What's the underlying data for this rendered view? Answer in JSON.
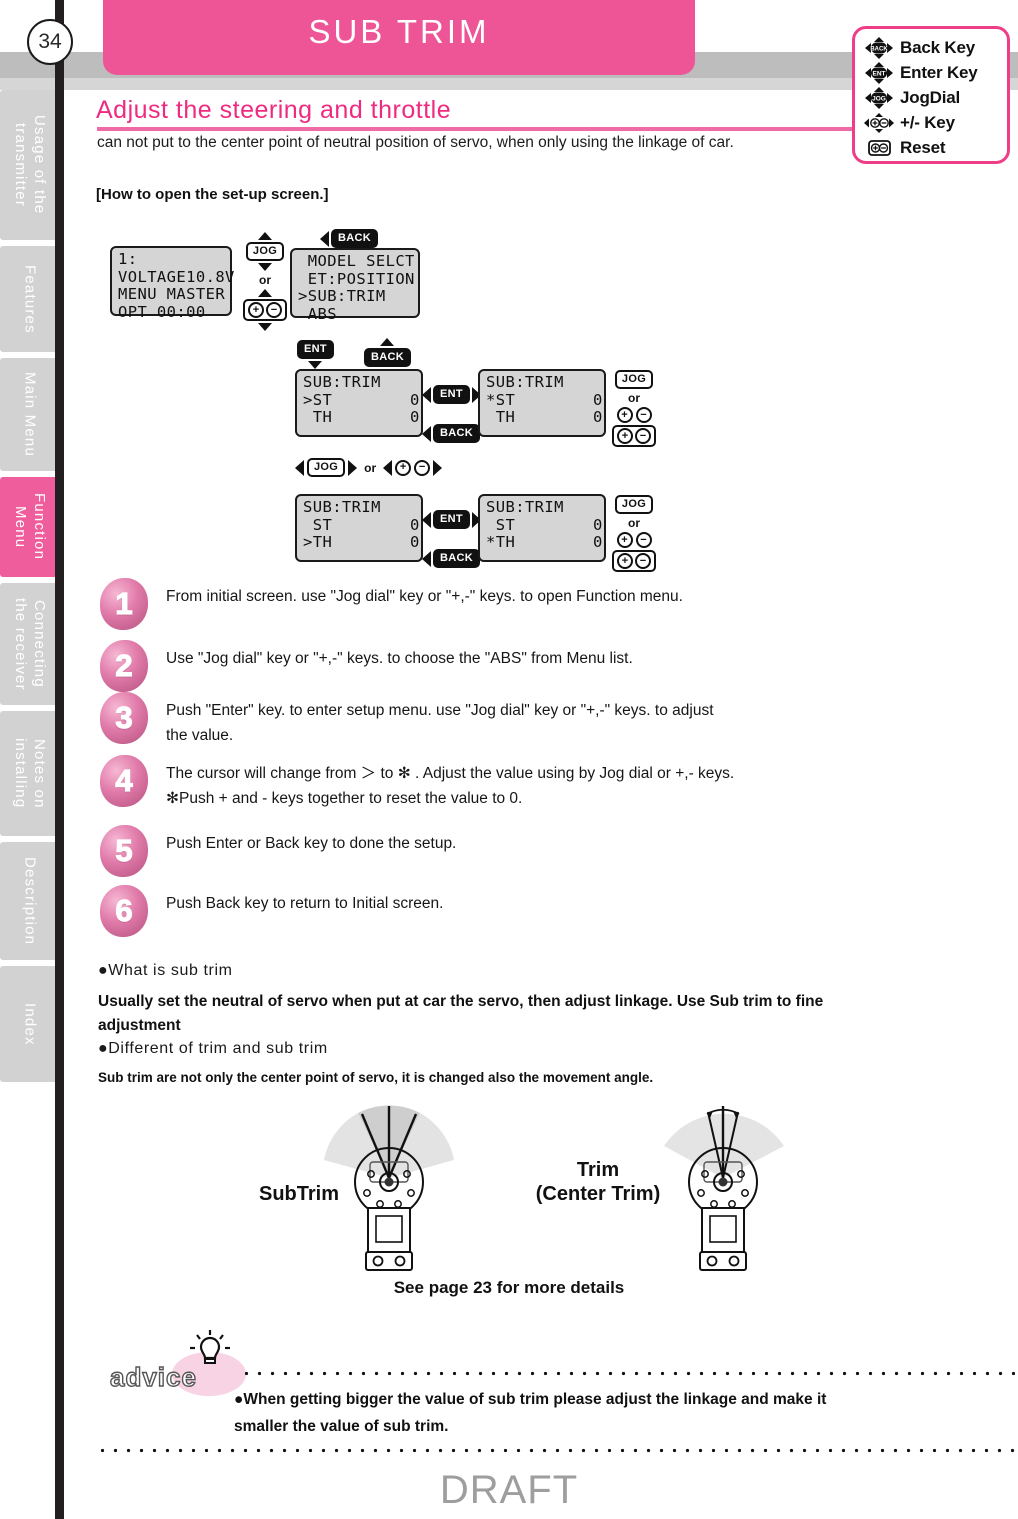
{
  "page": {
    "number": "34",
    "title": "SUB TRIM",
    "draft_watermark": "DRAFT",
    "accent_pink": "#ee2b80",
    "header_pink": "#ee5596"
  },
  "sidebar": {
    "tabs": [
      {
        "label": "Usage of the\ntransmitter",
        "active": false
      },
      {
        "label": "Features",
        "active": false
      },
      {
        "label": "Main Menu",
        "active": false
      },
      {
        "label": "Function Menu",
        "active": true
      },
      {
        "label": "Connecting\nthe receiver",
        "active": false
      },
      {
        "label": "Notes on\ninstalling",
        "active": false
      },
      {
        "label": "Description",
        "active": false
      },
      {
        "label": "Index",
        "active": false
      }
    ]
  },
  "key_legend": [
    {
      "icon": "back-key-icon",
      "key": "BACK",
      "label": "Back Key"
    },
    {
      "icon": "enter-key-icon",
      "key": "ENT",
      "label": "Enter Key"
    },
    {
      "icon": "jogdial-icon",
      "key": "JOG",
      "label": "JogDial"
    },
    {
      "icon": "plus-minus-key-icon",
      "key": "+-",
      "label": "+/- Key"
    },
    {
      "icon": "reset-key-icon",
      "key": "+-",
      "label": "Reset"
    }
  ],
  "section": {
    "heading": "Adjust the steering and throttle",
    "subtext": "can not put to the center point of neutral position of servo, when only using the linkage of car.",
    "howto_label": "[How to open the set-up screen.]"
  },
  "screens": {
    "initial": "1:\nVOLTAGE10.8V\nMENU MASTER\nOPT 00:00",
    "menu_list": " MODEL SELCT\n ET:POSITION\n>SUB:TRIM\n ABS",
    "subtrim_st_cursor": "SUB:TRIM\n>ST        0\n TH        0",
    "subtrim_st_selected": "SUB:TRIM\n*ST        0\n TH        0",
    "subtrim_th_cursor": "SUB:TRIM\n ST        0\n>TH        0",
    "subtrim_th_selected": "SUB:TRIM\n ST        0\n*TH        0"
  },
  "flow_labels": {
    "jog": "JOG",
    "ent": "ENT",
    "back": "BACK",
    "or": "or",
    "plus": "+",
    "minus": "−"
  },
  "steps": [
    {
      "num": "1",
      "text": "From initial screen. use \"Jog dial\" key or \"+,-\" keys. to open Function menu."
    },
    {
      "num": "2",
      "text": "Use \"Jog dial\" key or \"+,-\" keys. to choose the \"ABS\" from Menu list."
    },
    {
      "num": "3",
      "text": "Push \"Enter\" key. to enter setup menu. use \"Jog dial\" key or \"+,-\" keys. to adjust\nthe value."
    },
    {
      "num": "4",
      "text": "The cursor will change from ＞ to ✻ . Adjust the value using by Jog dial or +,- keys.\n✻Push + and - keys together to reset the value to 0."
    },
    {
      "num": "5",
      "text": "Push Enter or Back key to done the setup."
    },
    {
      "num": "6",
      "text": "Push Back key to return to Initial screen."
    }
  ],
  "explain": {
    "head1": "●What is sub trim",
    "para1": "Usually set the neutral of servo when put at car the servo, then adjust linkage. Use Sub trim to fine\nadjustment",
    "head2": "●Different of trim and sub trim",
    "para2": "Sub trim are not only the center point of servo, it is changed also the movement angle."
  },
  "figures": {
    "left_label": "SubTrim",
    "right_label": "Trim\n(Center Trim)",
    "see_page": "See page 23 for more details"
  },
  "advice": {
    "word": "advice",
    "text": "●When getting bigger the value of sub trim please adjust the linkage and make it\nsmaller the value of sub trim."
  }
}
